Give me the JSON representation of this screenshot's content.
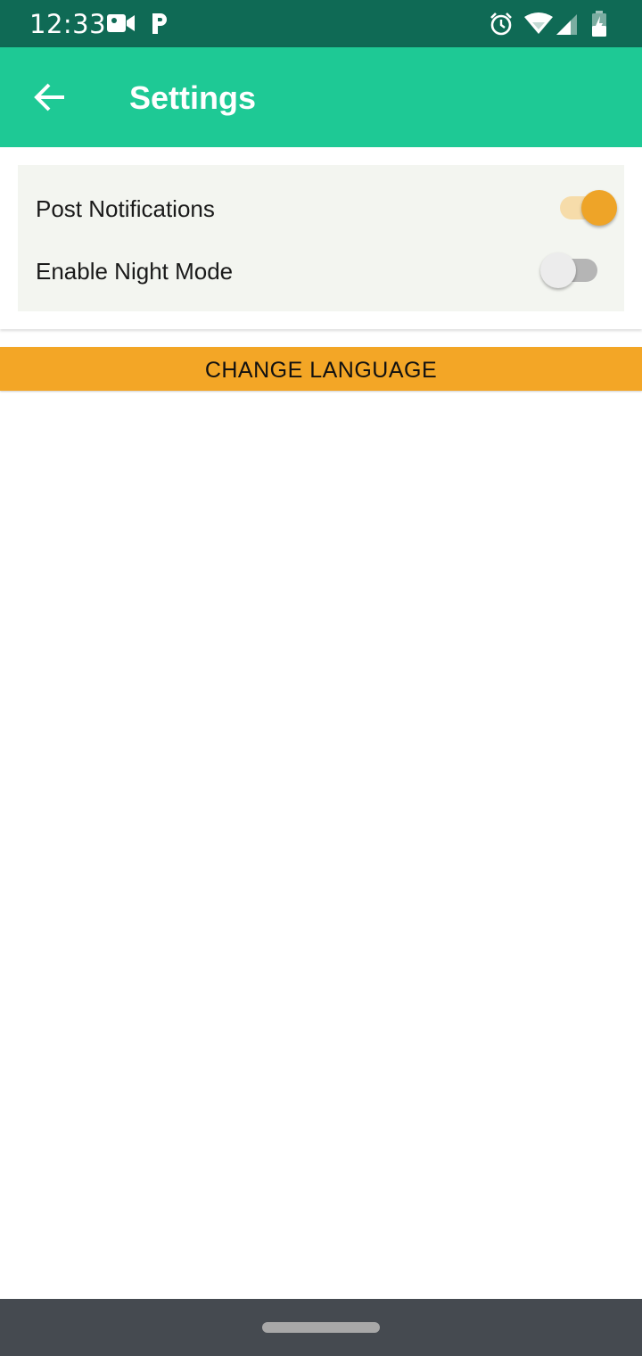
{
  "status_bar": {
    "time": "12:33",
    "icons": [
      "video-camera-icon",
      "parking-icon",
      "alarm-icon",
      "wifi-icon",
      "cell-signal-icon",
      "battery-charging-icon"
    ]
  },
  "app_bar": {
    "back_icon": "arrow-left-icon",
    "title": "Settings"
  },
  "settings": {
    "items": [
      {
        "label": "Post Notifications",
        "enabled": true
      },
      {
        "label": "Enable Night Mode",
        "enabled": false
      }
    ]
  },
  "change_language": {
    "label": "CHANGE LANGUAGE"
  },
  "colors": {
    "status_bar": "#0f6a55",
    "app_bar": "#1ec995",
    "accent": "#f3a626",
    "nav_bar": "#454a50"
  }
}
